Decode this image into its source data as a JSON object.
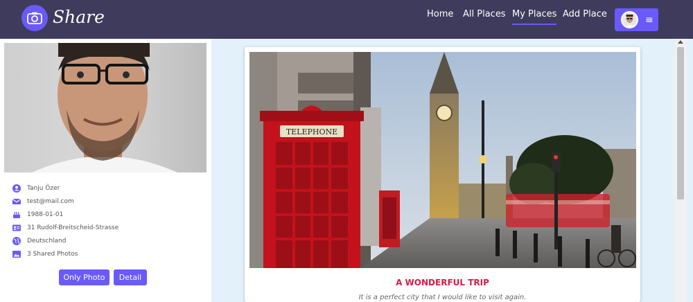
{
  "brand": {
    "name": "Share",
    "logo_icon": "camera-icon"
  },
  "nav": {
    "links": [
      {
        "label": "Home"
      },
      {
        "label": "All Places"
      },
      {
        "label": "My Places",
        "active": true
      },
      {
        "label": "Add Place"
      }
    ],
    "menu_icon": "hamburger-icon"
  },
  "profile": {
    "name": "Tanju Özer",
    "email": "test@mail.com",
    "birthdate": "1988-01-01",
    "address": "31 Rudolf-Breitscheid-Strasse",
    "country": "Deutschland",
    "shared": "3 Shared Photos"
  },
  "sidebar_buttons": {
    "only_photo": "Only Photo",
    "detail": "Detail"
  },
  "place": {
    "title": "A WONDERFUL TRIP",
    "description": "It is a perfect city that I would like to visit again.",
    "sign_text": "TELEPHONE"
  },
  "colors": {
    "nav_bg": "#3f3b5c",
    "accent": "#6a5af9",
    "title": "#d81b47",
    "page_bg": "#e3f1fb"
  }
}
